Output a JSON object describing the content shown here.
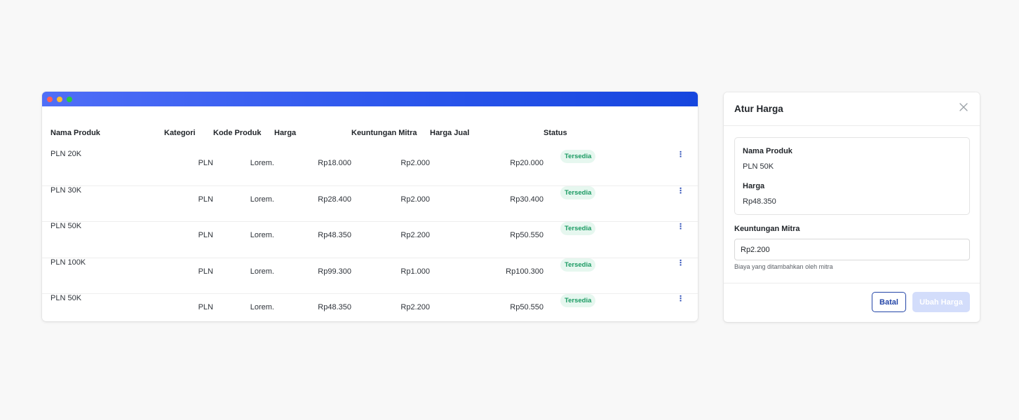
{
  "table": {
    "columns": {
      "name": "Nama Produk",
      "category": "Kategori",
      "code": "Kode Produk",
      "price": "Harga",
      "partner_profit": "Keuntungan Mitra",
      "sell_price": "Harga Jual",
      "status": "Status"
    },
    "rows": [
      {
        "name": "PLN 20K",
        "category": "PLN",
        "code": "Lorem.",
        "price": "Rp18.000",
        "partner_profit": "Rp2.000",
        "sell_price": "Rp20.000",
        "status": "Tersedia"
      },
      {
        "name": "PLN 30K",
        "category": "PLN",
        "code": "Lorem.",
        "price": "Rp28.400",
        "partner_profit": "Rp2.000",
        "sell_price": "Rp30.400",
        "status": "Tersedia"
      },
      {
        "name": "PLN 50K",
        "category": "PLN",
        "code": "Lorem.",
        "price": "Rp48.350",
        "partner_profit": "Rp2.200",
        "sell_price": "Rp50.550",
        "status": "Tersedia"
      },
      {
        "name": "PLN 100K",
        "category": "PLN",
        "code": "Lorem.",
        "price": "Rp99.300",
        "partner_profit": "Rp1.000",
        "sell_price": "Rp100.300",
        "status": "Tersedia"
      },
      {
        "name": "PLN 50K",
        "category": "PLN",
        "code": "Lorem.",
        "price": "Rp48.350",
        "partner_profit": "Rp2.200",
        "sell_price": "Rp50.550",
        "status": "Tersedia"
      }
    ],
    "row_menu_icon": "more-vertical-icon"
  },
  "modal": {
    "title": "Atur Harga",
    "close_icon": "close-icon",
    "product_label": "Nama Produk",
    "product_value": "PLN 50K",
    "price_label": "Harga",
    "price_value": "Rp48.350",
    "profit_label": "Keuntungan Mitra",
    "profit_value": "Rp2.200",
    "profit_help": "Biaya yang ditambahkan oleh mitra",
    "cancel_label": "Batal",
    "submit_label": "Ubah Harga"
  },
  "colors": {
    "titlebar_gradient_start": "#4f6ef7",
    "titlebar_gradient_end": "#1646de",
    "status_badge_bg": "#e6f7ef",
    "status_badge_text": "#1a9a62",
    "primary_outline": "#2446a8",
    "disabled_button": "#d3ddfb"
  }
}
